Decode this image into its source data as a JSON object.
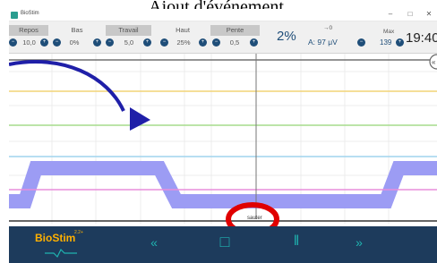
{
  "heading": "Ajout d'événement.",
  "window": {
    "app_title": "BioStim",
    "minimize": "–",
    "maximize": "□",
    "close": "✕"
  },
  "params": {
    "repos": {
      "label": "Repos",
      "value": "10,0"
    },
    "bas": {
      "label": "Bas",
      "value": "0%"
    },
    "travail": {
      "label": "Travail",
      "value": "5,0"
    },
    "haut": {
      "label": "Haut",
      "value": "25%"
    },
    "pente": {
      "label": "Pente",
      "value": "0,5"
    },
    "percent": "2%",
    "arrow_zero": "→0",
    "amplitude": "A: 97 μV",
    "max_label": "Max",
    "max_value": "139",
    "clock": "19:40"
  },
  "graph": {
    "marker_label": "sauter",
    "corner_button": "«",
    "colors": {
      "yellow_line": "#f2d477",
      "green_line": "#a6dc8c",
      "blue_line": "#9fd3ee",
      "magenta_line": "#e88ddc",
      "signal": "#9c9cf4",
      "arrow": "#1f1fa8",
      "highlight": "#e00000"
    }
  },
  "controls": {
    "brand": "BioStim",
    "brand_sup": "2.2+",
    "rewind": "«",
    "stop": "□",
    "pause": "‖",
    "forward": "»"
  }
}
